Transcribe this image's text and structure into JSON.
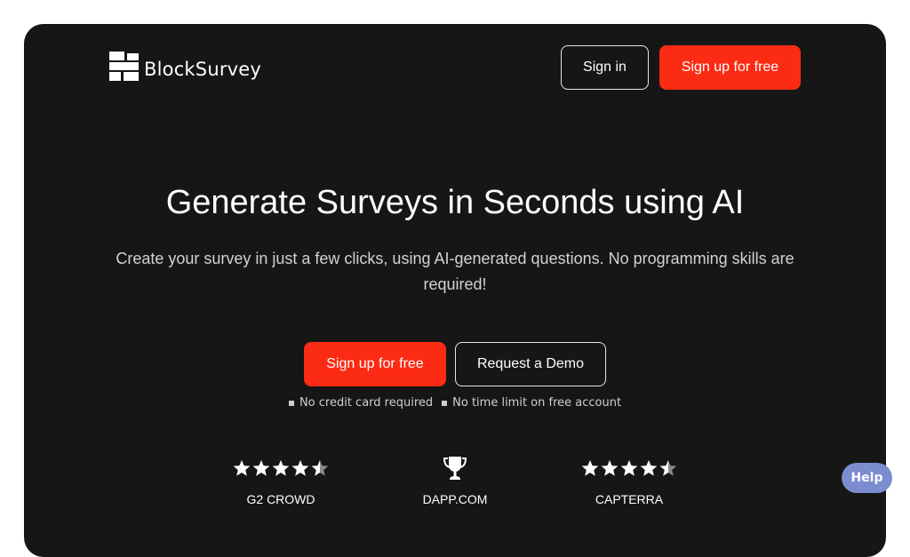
{
  "header": {
    "logo_text": "BlockSurvey",
    "logo_icon": "blocksurvey-logo-icon",
    "sign_in_label": "Sign in",
    "sign_up_label": "Sign up for free"
  },
  "hero": {
    "title": "Generate Surveys in Seconds using AI",
    "subtitle": "Create your survey in just a few clicks, using AI-generated questions. No programming skills are required!",
    "primary_cta": "Sign up for free",
    "secondary_cta": "Request a Demo",
    "notes": [
      "No credit card required",
      "No time limit on free account"
    ]
  },
  "awards": [
    {
      "label": "G2 CROWD",
      "icon": "star-rating",
      "rating": 4.5,
      "max": 5
    },
    {
      "label": "DAPP.COM",
      "icon": "trophy-icon"
    },
    {
      "label": "CAPTERRA",
      "icon": "star-rating",
      "rating": 4.5,
      "max": 5
    }
  ],
  "help": {
    "label": "Help"
  },
  "colors": {
    "background": "#161616",
    "accent": "#fb2b14",
    "help": "#7b8ccf"
  }
}
